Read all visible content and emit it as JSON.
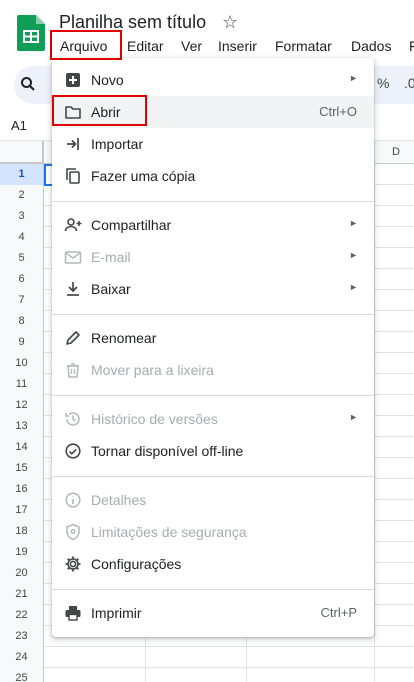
{
  "app": {
    "doc_title": "Planilha sem título",
    "star_icon": "star-outline-icon",
    "brand_color": "#0f9d58"
  },
  "menubar": [
    "Arquivo",
    "Editar",
    "Ver",
    "Inserir",
    "Formatar",
    "Dados",
    "F"
  ],
  "toolbar": {
    "percent": "%",
    "decimal": ".0"
  },
  "name_box": "A1",
  "columns": {
    "d": "D"
  },
  "rows": [
    "1",
    "2",
    "3",
    "4",
    "5",
    "6",
    "7",
    "8",
    "9",
    "10",
    "11",
    "12",
    "13",
    "14",
    "15",
    "16",
    "17",
    "18",
    "19",
    "20",
    "21",
    "22",
    "23",
    "24",
    "25"
  ],
  "file_menu": [
    {
      "label": "Novo",
      "icon": "new-sheet-icon",
      "arrow": "►"
    },
    {
      "label": "Abrir",
      "icon": "folder-icon",
      "shortcut": "Ctrl+O"
    },
    {
      "label": "Importar",
      "icon": "import-icon"
    },
    {
      "label": "Fazer uma cópia",
      "icon": "copy-icon"
    },
    {
      "label": "Compartilhar",
      "icon": "share-person-icon",
      "arrow": "►"
    },
    {
      "label": "E-mail",
      "icon": "mail-icon",
      "arrow": "►",
      "disabled": true
    },
    {
      "label": "Baixar",
      "icon": "download-icon",
      "arrow": "►"
    },
    {
      "label": "Renomear",
      "icon": "pencil-icon"
    },
    {
      "label": "Mover para a lixeira",
      "icon": "trash-icon",
      "disabled": true
    },
    {
      "label": "Histórico de versões",
      "icon": "history-icon",
      "arrow": "►",
      "disabled": true
    },
    {
      "label": "Tornar disponível off-line",
      "icon": "offline-check-icon"
    },
    {
      "label": "Detalhes",
      "icon": "info-icon",
      "disabled": true
    },
    {
      "label": "Limitações de segurança",
      "icon": "shield-icon",
      "disabled": true
    },
    {
      "label": "Configurações",
      "icon": "gear-icon"
    },
    {
      "label": "Imprimir",
      "icon": "printer-icon",
      "shortcut": "Ctrl+P"
    }
  ],
  "highlight_color": "#e00000"
}
